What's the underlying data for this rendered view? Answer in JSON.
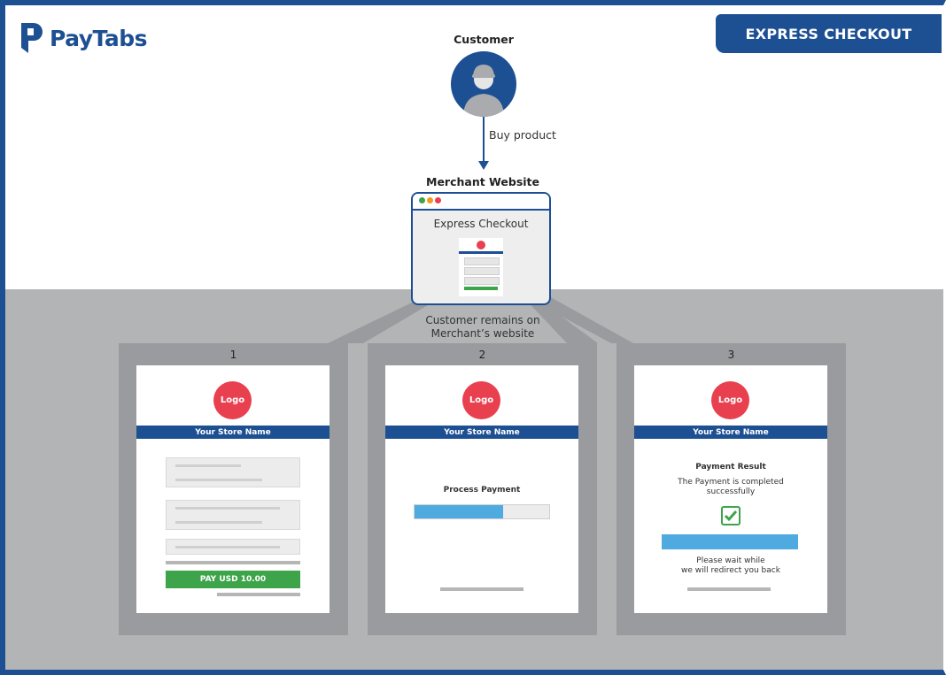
{
  "brand": {
    "name": "PayTabs",
    "color": "#1d4f93"
  },
  "banner": {
    "title": "EXPRESS CHECKOUT"
  },
  "customer": {
    "label": "Customer",
    "action": "Buy product"
  },
  "merchant": {
    "label": "Merchant Website",
    "window_title": "Express Checkout"
  },
  "note": {
    "line1": "Customer remains on",
    "line2": "Merchant’s website"
  },
  "panels": [
    {
      "number": "1",
      "logo": "Logo",
      "store": "Your Store Name",
      "pay_button": "PAY USD 10.00"
    },
    {
      "number": "2",
      "logo": "Logo",
      "store": "Your Store Name",
      "title": "Process Payment",
      "progress": 0.66
    },
    {
      "number": "3",
      "logo": "Logo",
      "store": "Your Store Name",
      "title": "Payment Result",
      "message_l1": "The Payment is completed",
      "message_l2": "successfully",
      "wait_l1": "Please wait while",
      "wait_l2": "we will redirect you back"
    }
  ],
  "colors": {
    "accent": "#1d4f93",
    "logo": "#e8404f",
    "success": "#3da44a",
    "progress": "#4eaadf",
    "gray": "#b3b4b6"
  }
}
